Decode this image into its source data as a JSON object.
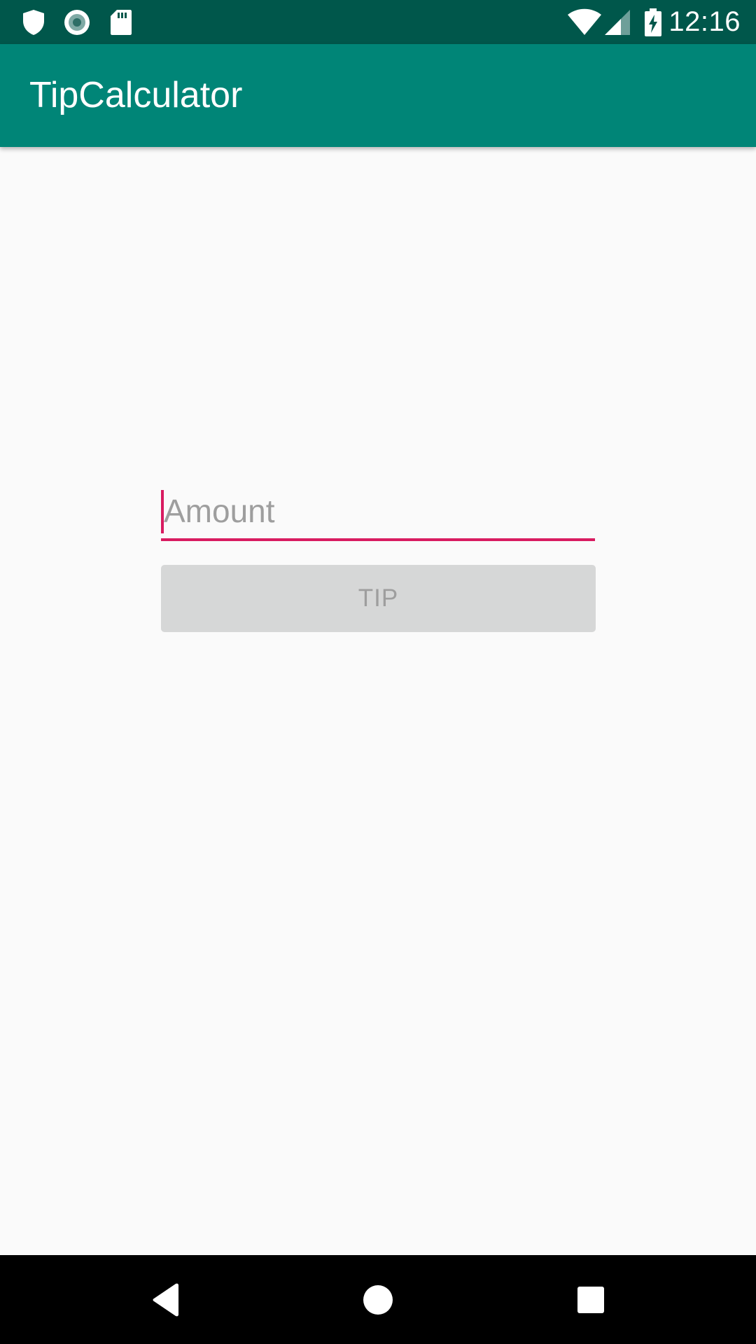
{
  "status_bar": {
    "time": "12:16",
    "left_icons": [
      "shield-icon",
      "record-icon",
      "sd-card-icon"
    ],
    "right_icons": [
      "wifi-icon",
      "cell-signal-icon",
      "battery-charging-icon"
    ],
    "background_color": "#00574B"
  },
  "app_bar": {
    "title": "TipCalculator",
    "background_color": "#008577"
  },
  "form": {
    "amount": {
      "value": "",
      "placeholder": "Amount",
      "focused": true,
      "accent_color": "#D81B60"
    },
    "tip_button": {
      "label": "TIP",
      "enabled": false
    }
  },
  "nav_bar": {
    "buttons": [
      "back-icon",
      "home-icon",
      "recents-icon"
    ]
  }
}
